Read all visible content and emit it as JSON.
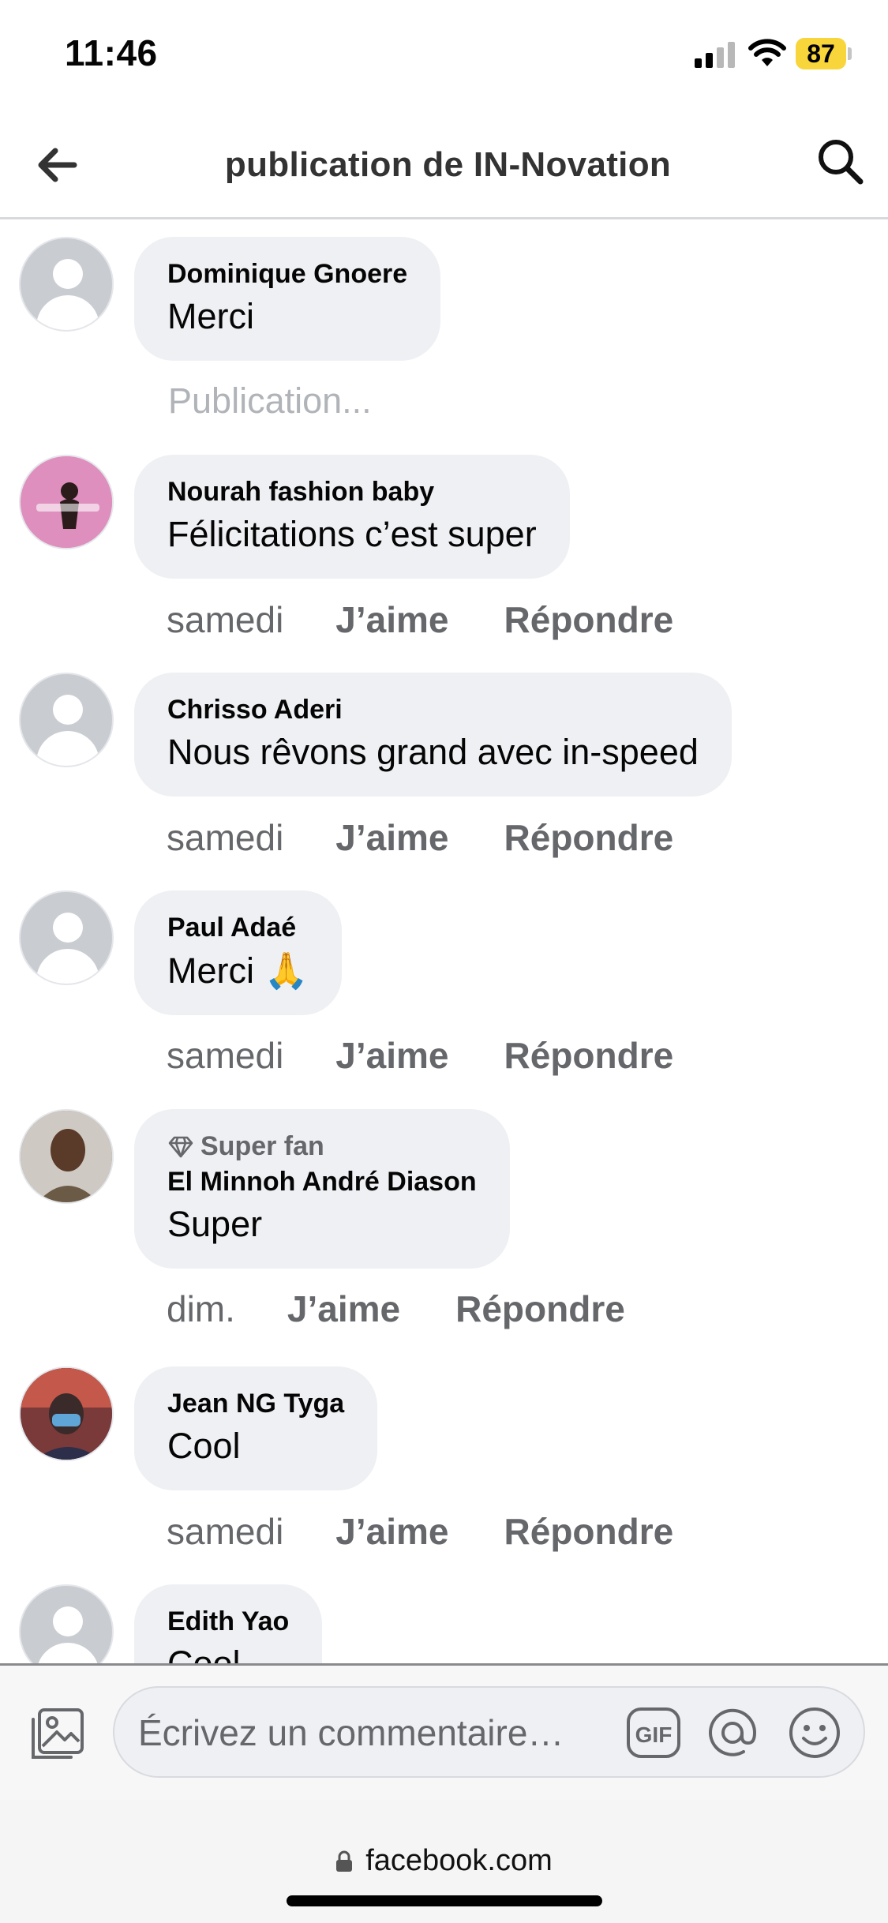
{
  "status_bar": {
    "time": "11:46",
    "battery": "87"
  },
  "header": {
    "title": "publication de IN-Novation"
  },
  "comments": [
    {
      "author": "Dominique Gnoere",
      "text": "Merci",
      "status": "Publication..."
    },
    {
      "author": "Nourah fashion baby",
      "text": "Félicitations c’est super",
      "time": "samedi",
      "like": "J’aime",
      "reply": "Répondre"
    },
    {
      "author": "Chrisso Aderi",
      "text": "Nous rêvons grand avec in-speed",
      "time": "samedi",
      "like": "J’aime",
      "reply": "Répondre"
    },
    {
      "author": "Paul Adaé",
      "text": "Merci 🙏",
      "time": "samedi",
      "like": "J’aime",
      "reply": "Répondre"
    },
    {
      "badge": "Super fan",
      "author": "El Minnoh André Diason",
      "text": "Super",
      "time": "dim.",
      "like": "J’aime",
      "reply": "Répondre"
    },
    {
      "author": "Jean NG Tyga",
      "text": "Cool",
      "time": "samedi",
      "like": "J’aime",
      "reply": "Répondre"
    },
    {
      "author": "Edith Yao",
      "text": "Cool"
    }
  ],
  "composer": {
    "placeholder": "Écrivez un commentaire…",
    "gif_label": "GIF"
  },
  "browser": {
    "url": "facebook.com"
  },
  "colors": {
    "bubble": "#eff0f3",
    "secondary_text": "#65676b",
    "battery": "#f8d53a"
  }
}
